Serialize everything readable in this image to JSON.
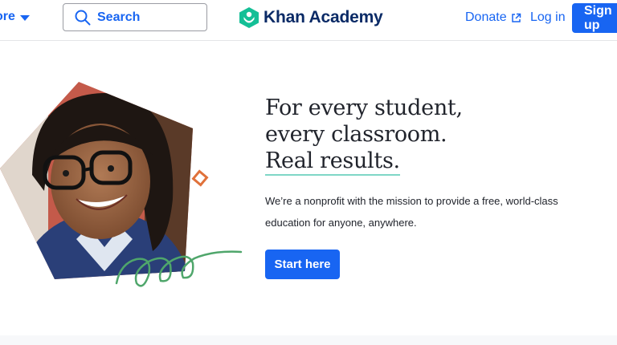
{
  "header": {
    "explore_label": "ore",
    "search_label": "Search",
    "logo_text": "Khan Academy",
    "donate_label": "Donate",
    "login_label": "Log in",
    "signup_label": "Sign up"
  },
  "hero": {
    "headline_lines": [
      "For every student,",
      "every classroom.",
      "Real results."
    ],
    "description_lines": [
      "We’re a nonprofit with the mission to provide a free, world-class",
      "education for anyone, anywhere."
    ],
    "cta_label": "Start here"
  },
  "colors": {
    "brand_blue": "#1865f2",
    "logo_green": "#14bf96",
    "logo_navy": "#0a2a66",
    "accent_orange": "#e0713a",
    "squiggle_green": "#4fa66b"
  }
}
